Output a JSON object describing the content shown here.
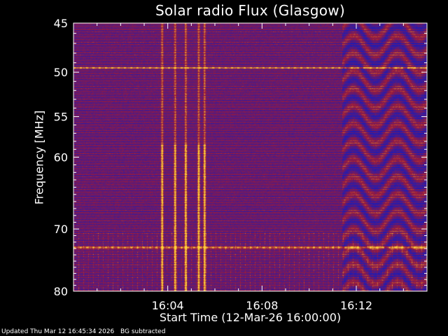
{
  "chart_data": {
    "type": "heatmap",
    "title": "Solar radio Flux (Glasgow)",
    "xlabel": "Start Time (12-Mar-26 16:00:00)",
    "ylabel": "Frequency [MHz]",
    "x_ticks": [
      "16:04",
      "16:08",
      "16:12"
    ],
    "x_tick_minutes": [
      4,
      8,
      12
    ],
    "xlim_minutes": [
      0,
      15
    ],
    "y_ticks": [
      45,
      50,
      55,
      60,
      70,
      80
    ],
    "ylim": [
      45,
      80
    ],
    "y_scale": "log",
    "colormap": {
      "low": "#1b1bb8",
      "mid": "#9b1a3a",
      "high": "#ffd23a"
    },
    "features": [
      {
        "kind": "persistent-band",
        "frequency_mhz": 49.5
      },
      {
        "kind": "persistent-band",
        "frequency_mhz": 72.8
      },
      {
        "kind": "burst",
        "minute": 3.75
      },
      {
        "kind": "burst",
        "minute": 4.3
      },
      {
        "kind": "burst",
        "minute": 4.75
      },
      {
        "kind": "burst",
        "minute": 5.3
      },
      {
        "kind": "burst",
        "minute": 5.55
      },
      {
        "kind": "interference-region",
        "minutes": [
          11.4,
          15
        ]
      }
    ]
  },
  "footer": {
    "updated": "Updated Thu Mar 12 16:45:34 2026",
    "note": "BG subtracted"
  }
}
